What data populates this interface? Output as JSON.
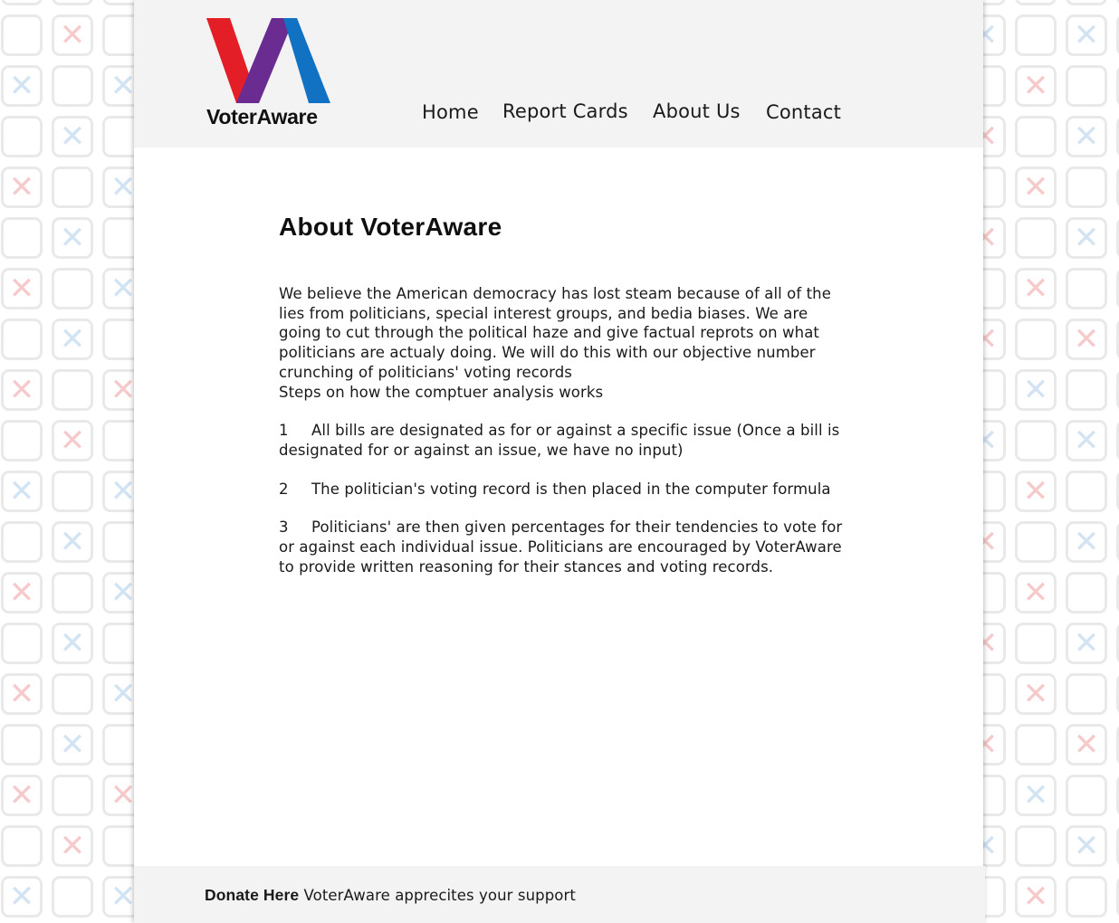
{
  "brand": {
    "name": "VoterAware",
    "colors": {
      "red": "#e41e26",
      "purple": "#6a2c91",
      "blue": "#1172c4"
    }
  },
  "nav": {
    "items": [
      {
        "label": "Home"
      },
      {
        "label": "Report Cards"
      },
      {
        "label": "About Us"
      },
      {
        "label": "Contact"
      }
    ]
  },
  "main": {
    "title": "About VoterAware",
    "intro": "We believe the American democracy has lost steam because of all of the lies from politicians, special interest groups, and bedia biases. We are going to cut through the political haze and give factual reprots on what politicians are actualy doing. We will do this with our objective number crunching of politicians' voting records",
    "steps_heading": "Steps on how the comptuer analysis works",
    "steps": [
      {
        "num": "1",
        "text": "All bills are designated as for or against a specific issue (Once a bill is designated for or against an issue, we have no input)"
      },
      {
        "num": "2",
        "text": "The politician's voting record is then placed in the computer formula"
      },
      {
        "num": "3",
        "text": "Politicians' are then given percentages for their tendencies to vote for or against each individual issue. Politicians are encouraged by VoterAware to provide written reasoning for their stances and voting records."
      }
    ]
  },
  "footer": {
    "donate_label": "Donate Here",
    "support_text": "VoterAware apprecites your support"
  }
}
